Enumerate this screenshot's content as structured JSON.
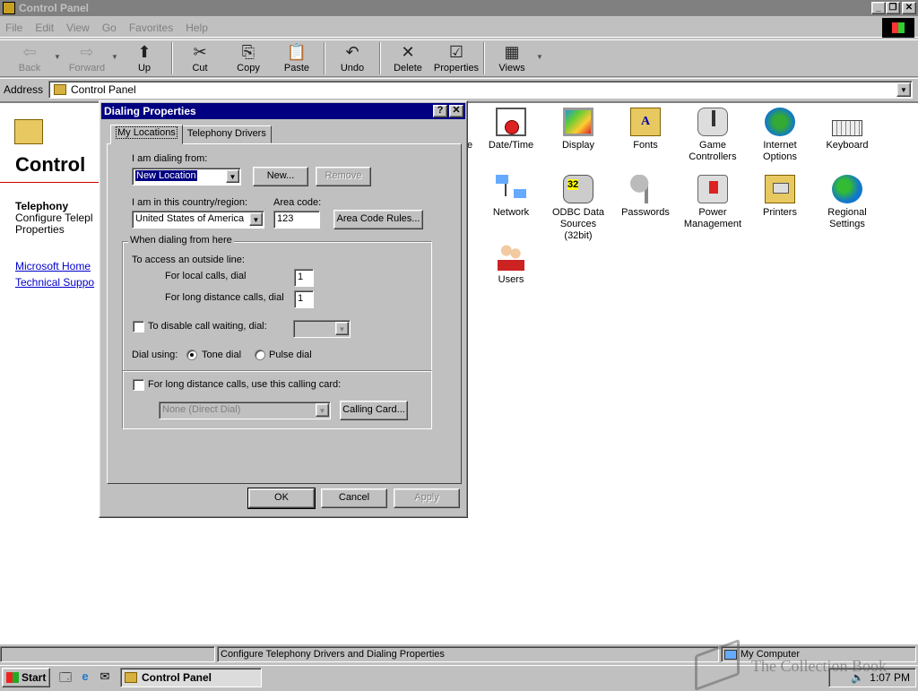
{
  "window": {
    "title": "Control Panel",
    "buttons": [
      "_",
      "❐",
      "✕"
    ]
  },
  "menu": [
    "File",
    "Edit",
    "View",
    "Go",
    "Favorites",
    "Help"
  ],
  "toolbar": [
    {
      "label": "Back",
      "icon": "back-arrow-icon",
      "glyph": "⇦",
      "disabled": true
    },
    {
      "label": "Forward",
      "icon": "forward-arrow-icon",
      "glyph": "⇨",
      "disabled": true
    },
    {
      "label": "Up",
      "icon": "up-folder-icon",
      "glyph": "⬆"
    },
    {
      "label": "Cut",
      "icon": "scissors-icon",
      "glyph": "✂"
    },
    {
      "label": "Copy",
      "icon": "copy-icon",
      "glyph": "⎘"
    },
    {
      "label": "Paste",
      "icon": "paste-icon",
      "glyph": "📋"
    },
    {
      "label": "Undo",
      "icon": "undo-icon",
      "glyph": "↶"
    },
    {
      "label": "Delete",
      "icon": "delete-x-icon",
      "glyph": "✕"
    },
    {
      "label": "Properties",
      "icon": "properties-icon",
      "glyph": "☑"
    },
    {
      "label": "Views",
      "icon": "views-icon",
      "glyph": "▦"
    }
  ],
  "address": {
    "label": "Address",
    "value": "Control Panel"
  },
  "left_pane": {
    "title": "Control",
    "selected_name": "Telephony",
    "selected_desc_1": "Configure Telepl",
    "selected_desc_2": "Properties",
    "link_1": "Microsoft Home",
    "link_2": "Technical Suppo"
  },
  "partial_label": "e",
  "icons": [
    {
      "label": "Date/Time",
      "icon": "calendar-clock-icon"
    },
    {
      "label": "Display",
      "icon": "monitor-icon"
    },
    {
      "label": "Fonts",
      "icon": "fonts-folder-icon"
    },
    {
      "label": "Game Controllers",
      "icon": "joystick-icon"
    },
    {
      "label": "Internet Options",
      "icon": "globe-tools-icon"
    },
    {
      "label": "Keyboard",
      "icon": "keyboard-icon"
    },
    {
      "label": "Network",
      "icon": "network-icon"
    },
    {
      "label": "ODBC Data Sources (32bit)",
      "icon": "database-icon"
    },
    {
      "label": "Passwords",
      "icon": "keys-icon"
    },
    {
      "label": "Power Management",
      "icon": "power-plug-icon"
    },
    {
      "label": "Printers",
      "icon": "printer-folder-icon"
    },
    {
      "label": "Regional Settings",
      "icon": "globe-icon"
    },
    {
      "label": "Users",
      "icon": "users-icon"
    }
  ],
  "dialog": {
    "title": "Dialing Properties",
    "help": "?",
    "close": "✕",
    "tabs": [
      "My Locations",
      "Telephony Drivers"
    ],
    "dialing_from_label": "I am dialing from:",
    "dialing_from_value": "New Location",
    "new_btn": "New...",
    "remove_btn": "Remove",
    "country_label": "I am in this country/region:",
    "country_value": "United States of America",
    "area_label": "Area code:",
    "area_value": "123",
    "area_rules_btn": "Area Code Rules...",
    "group_label": "When dialing from here",
    "outside_label": "To access an outside line:",
    "local_label": "For local calls, dial",
    "local_value": "1",
    "long_label": "For long distance calls, dial",
    "long_value": "1",
    "callwait_label": "To disable call waiting, dial:",
    "dial_using_label": "Dial using:",
    "tone_label": "Tone dial",
    "pulse_label": "Pulse dial",
    "calling_card_label": "For long distance calls, use this calling card:",
    "calling_card_value": "None (Direct Dial)",
    "calling_card_btn": "Calling Card...",
    "ok": "OK",
    "cancel": "Cancel",
    "apply": "Apply"
  },
  "status": {
    "text": "Configure Telephony Drivers and Dialing Properties",
    "zone": "My Computer"
  },
  "taskbar": {
    "start": "Start",
    "task": "Control Panel",
    "time": "1:07 PM"
  },
  "watermark": "The Collection Book"
}
